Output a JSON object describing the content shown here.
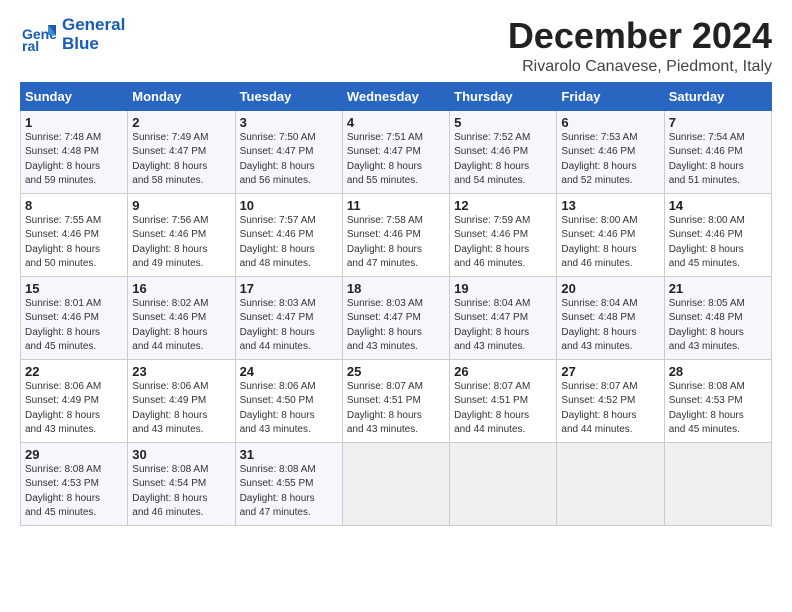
{
  "header": {
    "logo_text_top": "General",
    "logo_text_bottom": "Blue",
    "month_title": "December 2024",
    "location": "Rivarolo Canavese, Piedmont, Italy"
  },
  "days_of_week": [
    "Sunday",
    "Monday",
    "Tuesday",
    "Wednesday",
    "Thursday",
    "Friday",
    "Saturday"
  ],
  "weeks": [
    [
      {
        "day": "1",
        "info": "Sunrise: 7:48 AM\nSunset: 4:48 PM\nDaylight: 8 hours\nand 59 minutes."
      },
      {
        "day": "2",
        "info": "Sunrise: 7:49 AM\nSunset: 4:47 PM\nDaylight: 8 hours\nand 58 minutes."
      },
      {
        "day": "3",
        "info": "Sunrise: 7:50 AM\nSunset: 4:47 PM\nDaylight: 8 hours\nand 56 minutes."
      },
      {
        "day": "4",
        "info": "Sunrise: 7:51 AM\nSunset: 4:47 PM\nDaylight: 8 hours\nand 55 minutes."
      },
      {
        "day": "5",
        "info": "Sunrise: 7:52 AM\nSunset: 4:46 PM\nDaylight: 8 hours\nand 54 minutes."
      },
      {
        "day": "6",
        "info": "Sunrise: 7:53 AM\nSunset: 4:46 PM\nDaylight: 8 hours\nand 52 minutes."
      },
      {
        "day": "7",
        "info": "Sunrise: 7:54 AM\nSunset: 4:46 PM\nDaylight: 8 hours\nand 51 minutes."
      }
    ],
    [
      {
        "day": "8",
        "info": "Sunrise: 7:55 AM\nSunset: 4:46 PM\nDaylight: 8 hours\nand 50 minutes."
      },
      {
        "day": "9",
        "info": "Sunrise: 7:56 AM\nSunset: 4:46 PM\nDaylight: 8 hours\nand 49 minutes."
      },
      {
        "day": "10",
        "info": "Sunrise: 7:57 AM\nSunset: 4:46 PM\nDaylight: 8 hours\nand 48 minutes."
      },
      {
        "day": "11",
        "info": "Sunrise: 7:58 AM\nSunset: 4:46 PM\nDaylight: 8 hours\nand 47 minutes."
      },
      {
        "day": "12",
        "info": "Sunrise: 7:59 AM\nSunset: 4:46 PM\nDaylight: 8 hours\nand 46 minutes."
      },
      {
        "day": "13",
        "info": "Sunrise: 8:00 AM\nSunset: 4:46 PM\nDaylight: 8 hours\nand 46 minutes."
      },
      {
        "day": "14",
        "info": "Sunrise: 8:00 AM\nSunset: 4:46 PM\nDaylight: 8 hours\nand 45 minutes."
      }
    ],
    [
      {
        "day": "15",
        "info": "Sunrise: 8:01 AM\nSunset: 4:46 PM\nDaylight: 8 hours\nand 45 minutes."
      },
      {
        "day": "16",
        "info": "Sunrise: 8:02 AM\nSunset: 4:46 PM\nDaylight: 8 hours\nand 44 minutes."
      },
      {
        "day": "17",
        "info": "Sunrise: 8:03 AM\nSunset: 4:47 PM\nDaylight: 8 hours\nand 44 minutes."
      },
      {
        "day": "18",
        "info": "Sunrise: 8:03 AM\nSunset: 4:47 PM\nDaylight: 8 hours\nand 43 minutes."
      },
      {
        "day": "19",
        "info": "Sunrise: 8:04 AM\nSunset: 4:47 PM\nDaylight: 8 hours\nand 43 minutes."
      },
      {
        "day": "20",
        "info": "Sunrise: 8:04 AM\nSunset: 4:48 PM\nDaylight: 8 hours\nand 43 minutes."
      },
      {
        "day": "21",
        "info": "Sunrise: 8:05 AM\nSunset: 4:48 PM\nDaylight: 8 hours\nand 43 minutes."
      }
    ],
    [
      {
        "day": "22",
        "info": "Sunrise: 8:06 AM\nSunset: 4:49 PM\nDaylight: 8 hours\nand 43 minutes."
      },
      {
        "day": "23",
        "info": "Sunrise: 8:06 AM\nSunset: 4:49 PM\nDaylight: 8 hours\nand 43 minutes."
      },
      {
        "day": "24",
        "info": "Sunrise: 8:06 AM\nSunset: 4:50 PM\nDaylight: 8 hours\nand 43 minutes."
      },
      {
        "day": "25",
        "info": "Sunrise: 8:07 AM\nSunset: 4:51 PM\nDaylight: 8 hours\nand 43 minutes."
      },
      {
        "day": "26",
        "info": "Sunrise: 8:07 AM\nSunset: 4:51 PM\nDaylight: 8 hours\nand 44 minutes."
      },
      {
        "day": "27",
        "info": "Sunrise: 8:07 AM\nSunset: 4:52 PM\nDaylight: 8 hours\nand 44 minutes."
      },
      {
        "day": "28",
        "info": "Sunrise: 8:08 AM\nSunset: 4:53 PM\nDaylight: 8 hours\nand 45 minutes."
      }
    ],
    [
      {
        "day": "29",
        "info": "Sunrise: 8:08 AM\nSunset: 4:53 PM\nDaylight: 8 hours\nand 45 minutes."
      },
      {
        "day": "30",
        "info": "Sunrise: 8:08 AM\nSunset: 4:54 PM\nDaylight: 8 hours\nand 46 minutes."
      },
      {
        "day": "31",
        "info": "Sunrise: 8:08 AM\nSunset: 4:55 PM\nDaylight: 8 hours\nand 47 minutes."
      },
      {
        "day": "",
        "info": ""
      },
      {
        "day": "",
        "info": ""
      },
      {
        "day": "",
        "info": ""
      },
      {
        "day": "",
        "info": ""
      }
    ]
  ]
}
